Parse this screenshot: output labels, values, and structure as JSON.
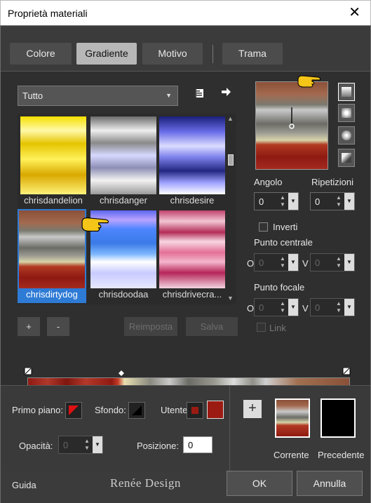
{
  "window": {
    "title": "Proprietà materiali",
    "close_glyph": "✕"
  },
  "tabs": [
    {
      "label": "Colore"
    },
    {
      "label": "Gradiente"
    },
    {
      "label": "Motivo"
    },
    {
      "label": "Trama"
    }
  ],
  "active_tab": "Gradiente",
  "gallery": {
    "filter_value": "Tutto",
    "items": [
      {
        "label": "chrisdandelion"
      },
      {
        "label": "chrisdanger"
      },
      {
        "label": "chrisdesire"
      },
      {
        "label": "chrisdirtydog"
      },
      {
        "label": "chrisdoodaa"
      },
      {
        "label": "chrisdrivecra..."
      }
    ],
    "selected": "chrisdirtydog",
    "buttons": {
      "add": "+",
      "remove": "-",
      "reset": "Reimposta",
      "save": "Salva"
    }
  },
  "settings": {
    "angle_label": "Angolo",
    "angle_value": "0",
    "repeats_label": "Ripetizioni",
    "repeats_value": "0",
    "invert_label": "Inverti",
    "center_label": "Punto centrale",
    "center_h_label": "O",
    "center_h_value": "0",
    "center_v_label": "V",
    "center_v_value": "0",
    "focal_label": "Punto focale",
    "focal_h_label": "O",
    "focal_h_value": "0",
    "focal_v_label": "V",
    "focal_v_value": "0",
    "link_label": "Link"
  },
  "stop_properties": {
    "foreground_label": "Primo piano:",
    "background_label": "Sfondo:",
    "user_label": "Utente:",
    "user_color": "#9b1b12",
    "opacity_label": "Opacità:",
    "opacity_value": "0",
    "position_label": "Posizione:",
    "position_value": "0"
  },
  "compare": {
    "add_glyph": "+",
    "current_label": "Corrente",
    "previous_label": "Precedente",
    "previous_color": "#000000"
  },
  "footer": {
    "help_label": "Guida",
    "logo_text": "Renée Design",
    "ok_label": "OK",
    "cancel_label": "Annulla"
  },
  "icons": {
    "close": "close-icon",
    "add_to_gallery": "book-icon",
    "arrow_right": "arrow-right-icon"
  },
  "colors": {
    "selection_blue": "#2e7bd6",
    "panel_bg": "#2f2f2f",
    "accent_red": "#9b1b12"
  }
}
